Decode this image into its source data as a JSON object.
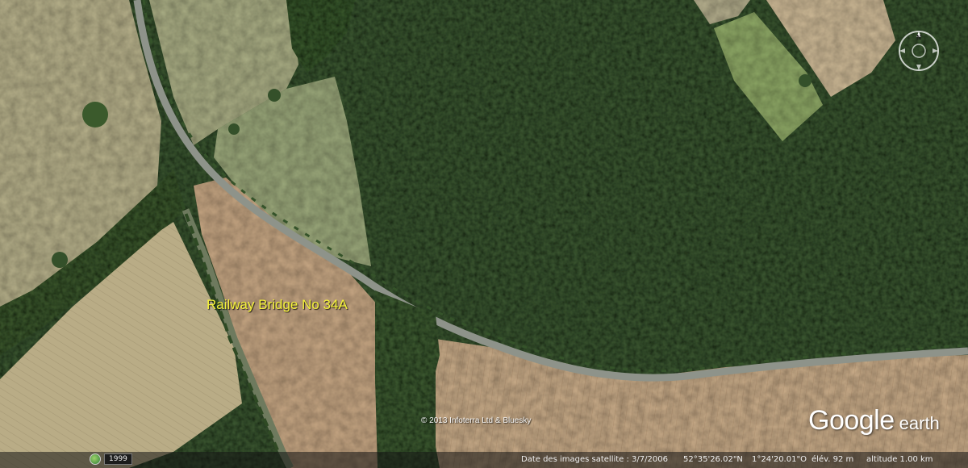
{
  "map": {
    "place_label": "Railway Bridge No 34A",
    "copyright": "© 2013 Infoterra Ltd & Bluesky",
    "brand_google": "Google",
    "brand_earth": "earth",
    "compass_north": "N"
  },
  "historical_imagery": {
    "icon": "clock-globe-icon",
    "year": "1999"
  },
  "status_bar": {
    "imagery_date": "Date des images satellite : 3/7/2006",
    "latitude": "52°35'26.02\"N",
    "longitude": "1°24'20.01\"O",
    "elevation": "élév.   92 m",
    "altitude": "altitude   1.00 km"
  },
  "colors": {
    "label_yellow": "#f4f23a",
    "forest_dark": "#3a5a30",
    "field_tan": "#c9b08a",
    "field_green": "#8fa56a",
    "road": "#8a8f86"
  }
}
